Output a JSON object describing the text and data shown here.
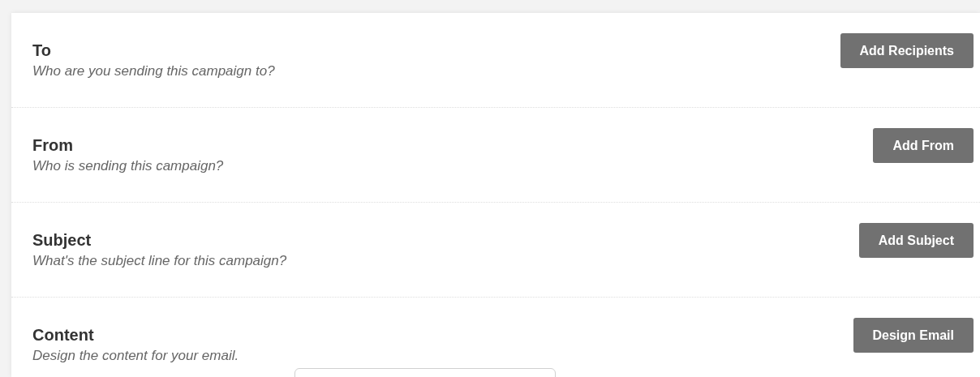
{
  "sections": [
    {
      "title": "To",
      "description": "Who are you sending this campaign to?",
      "button": "Add Recipients"
    },
    {
      "title": "From",
      "description": "Who is sending this campaign?",
      "button": "Add From"
    },
    {
      "title": "Subject",
      "description": "What's the subject line for this campaign?",
      "button": "Add Subject"
    },
    {
      "title": "Content",
      "description": "Design the content for your email.",
      "button": "Design Email"
    }
  ]
}
